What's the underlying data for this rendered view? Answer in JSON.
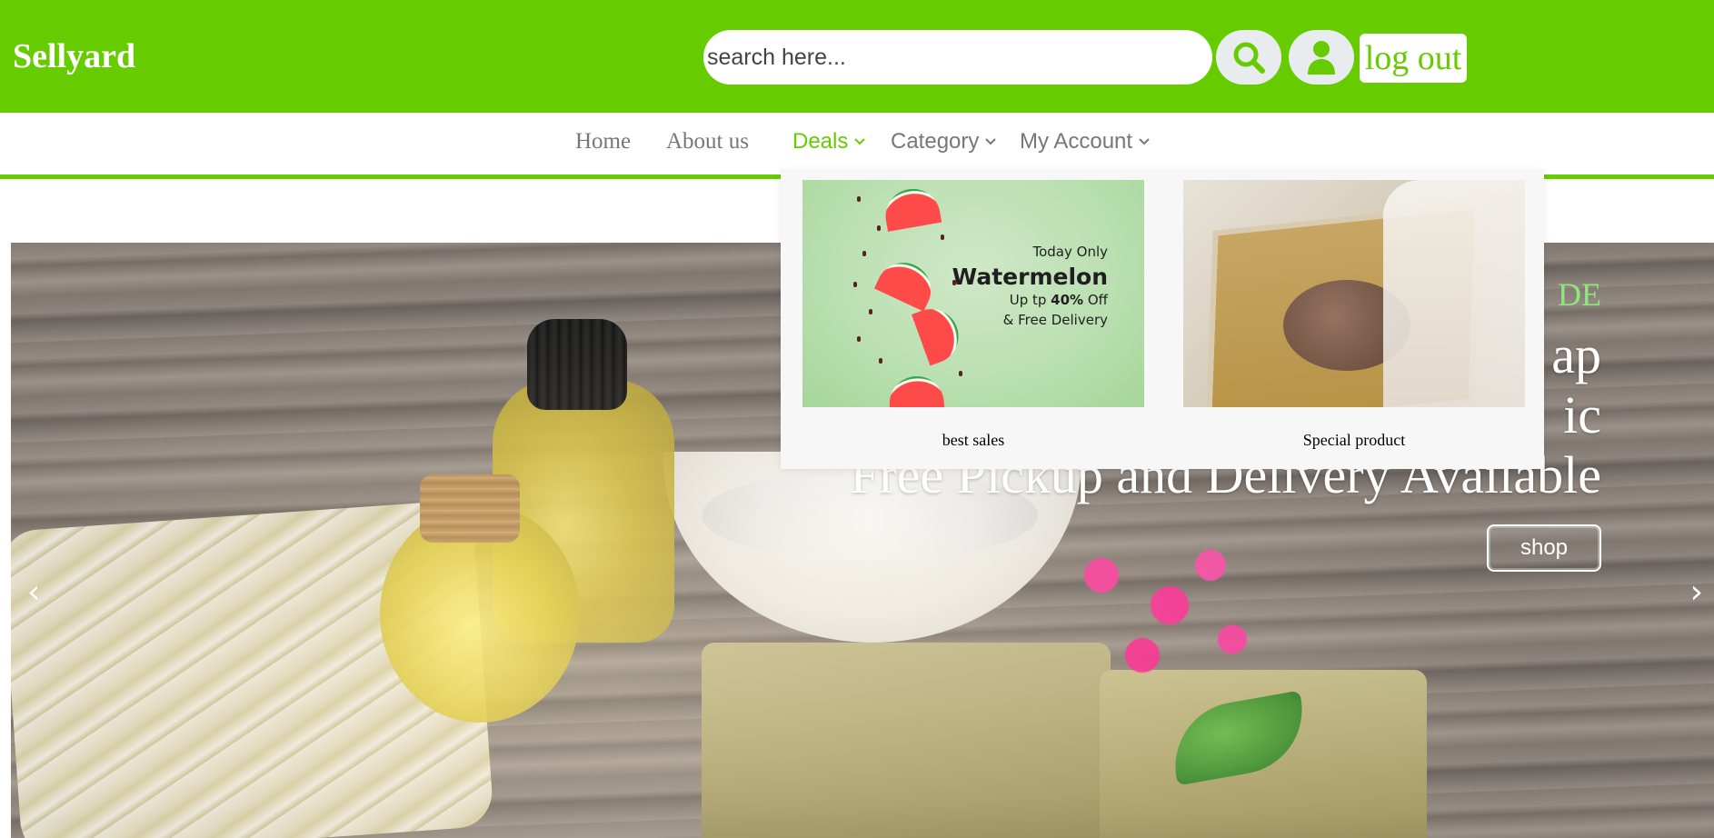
{
  "header": {
    "brand": "Sellyard",
    "search_placeholder": "search here...",
    "search_icon": "search-icon",
    "user_icon": "user-icon",
    "logout_label": "log out",
    "accent_color": "#66cc00"
  },
  "nav": {
    "items": [
      {
        "label": "Home"
      },
      {
        "label": "About us"
      },
      {
        "label": "Deals"
      },
      {
        "label": "Category"
      },
      {
        "label": "My Account"
      }
    ],
    "active": "Deals"
  },
  "dropdown": {
    "cards": [
      {
        "label": "best sales",
        "promo": {
          "today": "Today Only",
          "title": "Watermelon",
          "sub_prefix": "Up tp ",
          "sub_bold": "40%",
          "sub_suffix": " Off",
          "delivery": "& Free Delivery"
        }
      },
      {
        "label": "Special product"
      }
    ]
  },
  "hero": {
    "eyebrow": "DE",
    "line1": "ap",
    "line2": "ic",
    "line3": "Free Pickup and Delivery Available",
    "shop_label": "shop",
    "prev_arrow": "‹",
    "next_arrow": "›"
  }
}
